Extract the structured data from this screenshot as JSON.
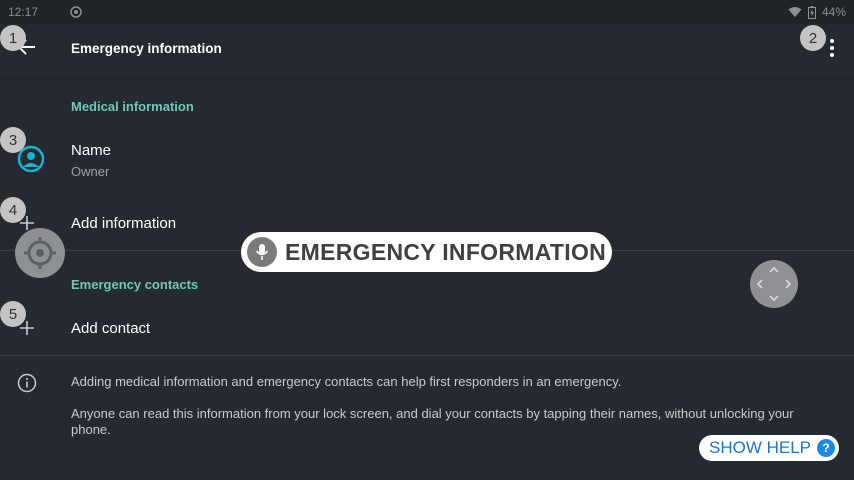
{
  "status_bar": {
    "time": "12:17",
    "battery": "44%",
    "icons": [
      "sync-icon",
      "wifi-icon",
      "battery-charging-icon"
    ]
  },
  "app_bar": {
    "title": "Emergency information",
    "back_icon": "arrow-back-icon",
    "more_icon": "more-vert-icon"
  },
  "medical": {
    "section_title": "Medical information",
    "name_title": "Name",
    "name_value": "Owner",
    "add_information": "Add information"
  },
  "contacts": {
    "section_title": "Emergency contacts",
    "add_contact": "Add contact"
  },
  "info": {
    "line1": "Adding medical information and emergency contacts can help first responders in an emergency.",
    "line2": "Anyone can read this information from your lock screen, and dial your contacts by tapping their names, without unlocking your phone."
  },
  "overlay": {
    "badges": [
      "1",
      "2",
      "3",
      "4",
      "5"
    ],
    "voice_command": "EMERGENCY INFORMATION",
    "help_label": "SHOW HELP",
    "help_q": "?"
  },
  "colors": {
    "background": "#242a30",
    "accent_teal": "#6ec7b8",
    "avatar_cyan": "#17b3d6",
    "help_blue": "#1976d2"
  }
}
